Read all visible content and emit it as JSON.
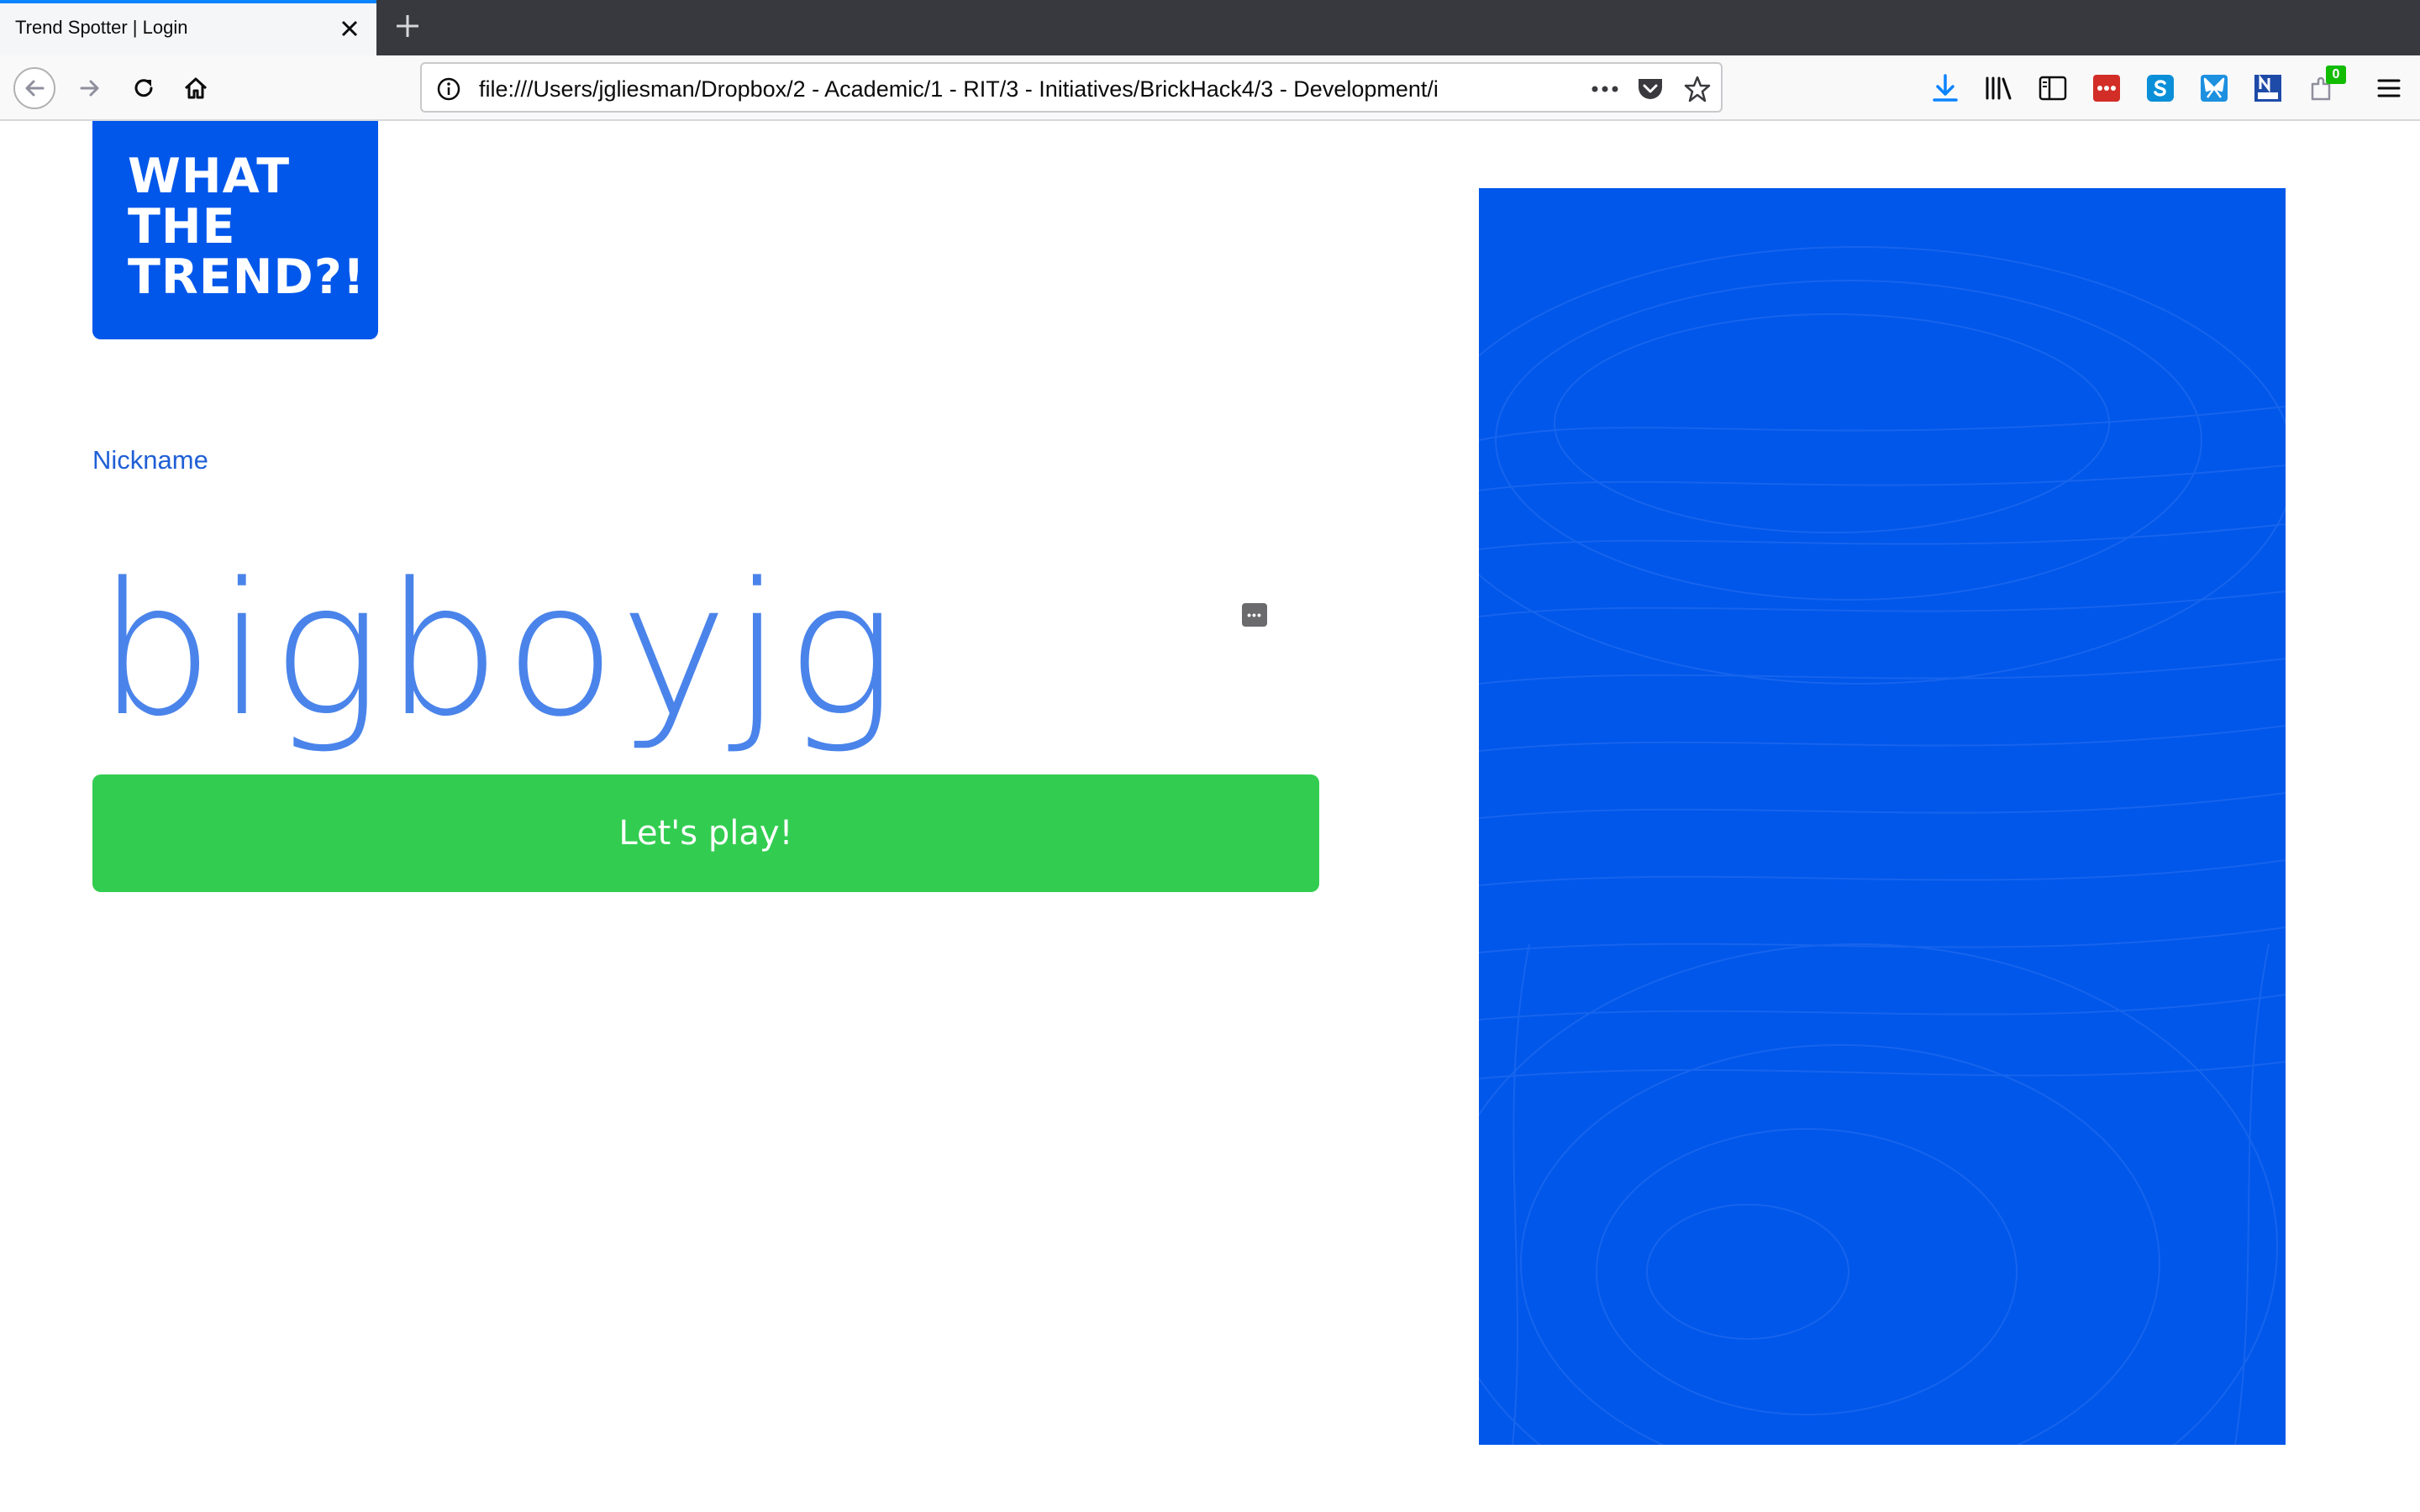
{
  "browser": {
    "tab": {
      "title": "Trend Spotter | Login"
    },
    "url": "file:///Users/jgliesman/Dropbox/2 - Academic/1 - RIT/3 - Initiatives/BrickHack4/3 - Development/i",
    "extension_badge": "0"
  },
  "page": {
    "logo_lines": [
      "WHAT",
      "THE",
      "TREND?!"
    ],
    "nickname_label": "Nickname",
    "nickname_value": "bigboyjg",
    "play_button": "Let's play!"
  },
  "colors": {
    "brand_blue": "#0057ea",
    "play_green": "#32cd50",
    "link_blue": "#1f5fd6"
  }
}
